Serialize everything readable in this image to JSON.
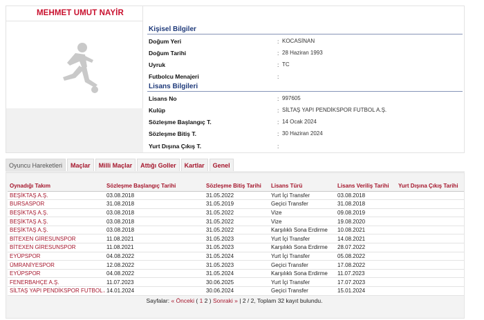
{
  "player": {
    "name": "MEHMET UMUT NAYİR"
  },
  "personal": {
    "heading": "Kişisel Bilgiler",
    "rows": [
      {
        "label": "Doğum Yeri",
        "value": "KOCASİNAN"
      },
      {
        "label": "Doğum Tarihi",
        "value": "28 Haziran 1993"
      },
      {
        "label": "Uyruk",
        "value": "TC"
      },
      {
        "label": "Futbolcu Menajeri",
        "value": ""
      }
    ]
  },
  "license": {
    "heading": "Lisans Bilgileri",
    "rows": [
      {
        "label": "Lisans No",
        "value": "997605"
      },
      {
        "label": "Kulüp",
        "value": "SİLTAŞ YAPI PENDİKSPOR FUTBOL A.Ş."
      },
      {
        "label": "Sözleşme Başlangıç T.",
        "value": "14 Ocak 2024"
      },
      {
        "label": "Sözleşme Bitiş T.",
        "value": "30 Haziran 2024"
      },
      {
        "label": "Yurt Dışına Çıkış T.",
        "value": ""
      }
    ]
  },
  "tabs": [
    {
      "label": "Oyuncu Hareketleri",
      "active": true
    },
    {
      "label": "Maçlar",
      "active": false
    },
    {
      "label": "Milli Maçlar",
      "active": false
    },
    {
      "label": "Attığı Goller",
      "active": false
    },
    {
      "label": "Kartlar",
      "active": false
    },
    {
      "label": "Genel",
      "active": false
    }
  ],
  "table": {
    "headers": [
      "Oynadığı Takım",
      "Sözleşme Başlangıç Tarihi",
      "Sözleşme Bitiş Tarihi",
      "Lisans Türü",
      "Lisans Veriliş Tarihi",
      "Yurt Dışına Çıkış Tarihi"
    ],
    "rows": [
      [
        "BEŞİKTAŞ A.Ş.",
        "03.08.2018",
        "31.05.2022",
        "Yurt İçi Transfer",
        "03.08.2018",
        ""
      ],
      [
        "BURSASPOR",
        "31.08.2018",
        "31.05.2019",
        "Geçici Transfer",
        "31.08.2018",
        ""
      ],
      [
        "BEŞİKTAŞ A.Ş.",
        "03.08.2018",
        "31.05.2022",
        "Vize",
        "09.08.2019",
        ""
      ],
      [
        "BEŞİKTAŞ A.Ş.",
        "03.08.2018",
        "31.05.2022",
        "Vize",
        "19.08.2020",
        ""
      ],
      [
        "BEŞİKTAŞ A.Ş.",
        "03.08.2018",
        "31.05.2022",
        "Karşılıklı Sona Erdirme",
        "10.08.2021",
        ""
      ],
      [
        "BİTEXEN GİRESUNSPOR",
        "11.08.2021",
        "31.05.2023",
        "Yurt İçi Transfer",
        "14.08.2021",
        ""
      ],
      [
        "BİTEXEN GİRESUNSPOR",
        "11.08.2021",
        "31.05.2023",
        "Karşılıklı Sona Erdirme",
        "28.07.2022",
        ""
      ],
      [
        "EYÜPSPOR",
        "04.08.2022",
        "31.05.2024",
        "Yurt İçi Transfer",
        "05.08.2022",
        ""
      ],
      [
        "ÜMRANİYESPOR",
        "12.08.2022",
        "31.05.2023",
        "Geçici Transfer",
        "17.08.2022",
        ""
      ],
      [
        "EYÜPSPOR",
        "04.08.2022",
        "31.05.2024",
        "Karşılıklı Sona Erdirme",
        "11.07.2023",
        ""
      ],
      [
        "FENERBAHÇE A.Ş.",
        "11.07.2023",
        "30.06.2025",
        "Yurt İçi Transfer",
        "17.07.2023",
        ""
      ],
      [
        "SİLTAŞ YAPI PENDİKSPOR FUTBOL A.Ş.",
        "14.01.2024",
        "30.06.2024",
        "Geçici Transfer",
        "15.01.2024",
        ""
      ]
    ]
  },
  "pager": {
    "prefix": "Sayfalar: ",
    "prev": "« Önceki",
    "open": " ( ",
    "page1": "1",
    "page2": "2",
    "close": " ) ",
    "next": "Sonraki »",
    "summary": " | 2 / 2, Toplam 32 kayıt bulundu."
  }
}
